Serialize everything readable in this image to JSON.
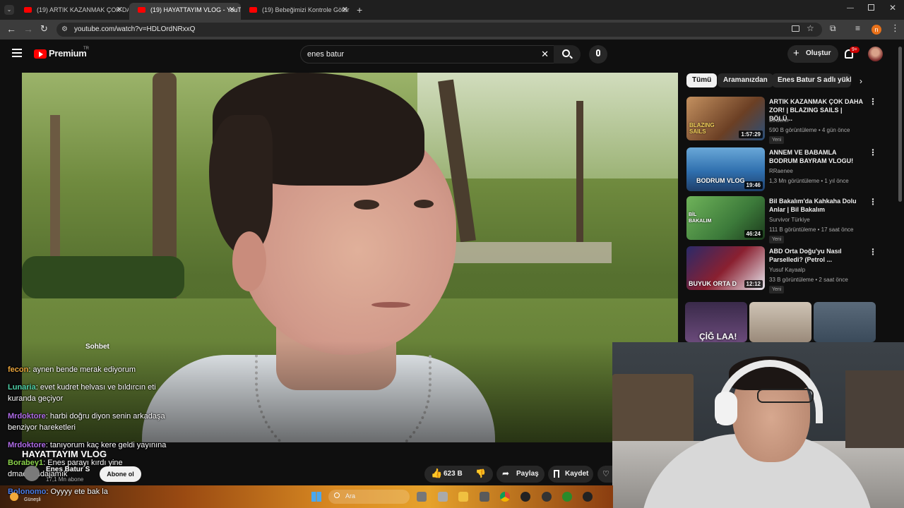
{
  "browser": {
    "tabs": [
      {
        "label": "(19) ARTIK KAZANMAK ÇOK DA",
        "active": false
      },
      {
        "label": "(19) HAYATTAYIM VLOG - YouT",
        "active": true
      },
      {
        "label": "(19) Bebeğimizi Kontrole Götür",
        "active": false
      }
    ],
    "url": "youtube.com/watch?v=HDLOrdNRxxQ",
    "profile_letter": "n"
  },
  "youtube": {
    "logo": "Premium",
    "logo_suffix": "TR",
    "search_value": "enes batur",
    "create_label": "Oluştur",
    "notifications_count": "9+"
  },
  "video": {
    "title": "HAYATTAYIM VLOG",
    "channel": "Enes Batur S",
    "subscribers": "17,1 Mn abone",
    "subscribe_label": "Abone ol",
    "likes": "623 B",
    "share_label": "Paylaş",
    "save_label": "Kaydet",
    "chat_heading": "Sohbet"
  },
  "chips": [
    "Tümü",
    "Aramanızdan",
    "Enes Batur S adlı yükley"
  ],
  "sidebar_videos": [
    {
      "title": "ARTIK KAZANMAK ÇOK DAHA ZOR! | BLAZING SAILS | BÖLÜ...",
      "channel": "Elraenn",
      "meta": "590 B görüntüleme • 4 gün önce",
      "badge": "Yeni",
      "duration": "1:57:29",
      "color": "#7a4a2a"
    },
    {
      "title": "ANNEM VE BABAMLA BODRUM BAYRAM VLOGU!",
      "channel": "RRaenee",
      "meta": "1,3 Mn görüntüleme • 1 yıl önce",
      "badge": "",
      "duration": "19:46",
      "color": "#2f6fae"
    },
    {
      "title": "Bil Bakalım'da Kahkaha Dolu Anlar | Bil Bakalım",
      "channel": "Survivor Türkiye",
      "meta": "111 B görüntüleme • 17 saat önce",
      "badge": "Yeni",
      "duration": "46:24",
      "color": "#3c7a3a"
    },
    {
      "title": "ABD Orta Doğu'yu Nasıl Parselledi? (Petrol ...",
      "channel": "Yusuf Kayaalp",
      "meta": "33 B görüntüleme • 2 saat önce",
      "badge": "Yeni",
      "duration": "12:12",
      "color": "#5a1f2a"
    }
  ],
  "thumb_texts": [
    "BLAZING SAILS",
    "BODRUM VLOG",
    "BİL BAKALIM",
    "BUYUK ORTA D",
    "ÇİĞ LAA!"
  ],
  "chat": [
    {
      "user": "fecon",
      "text": ": aynen bende merak ediyorum",
      "color": "#e8a33a"
    },
    {
      "user": "Lunaria",
      "text": ": evet kudret helvası ve bıldırcın eti kuranda geçiyor",
      "color": "#4fd1a8"
    },
    {
      "user": "Mrdoktore",
      "text": ": harbi doğru diyon senin arkadaşa benziyor hareketleri",
      "color": "#b06ce8"
    },
    {
      "user": "Mrdoktore",
      "text": ": tanıyorum kaç kere geldi yayınına",
      "color": "#b06ce8"
    },
    {
      "user": "Borabey1",
      "text": ": Enes parayı kırdı yine dmadrısndajamık",
      "color": "#8ad24a"
    },
    {
      "user": "Bolonomo",
      "text": ": Oyyyy ete bak la",
      "color": "#4a7de8"
    }
  ],
  "taskbar": {
    "search_label": "Ara",
    "weather_temp": "",
    "weather_label": "Güneşli"
  },
  "colors": {
    "youtube_red": "#ff0000",
    "bg": "#0f0f0f",
    "chip": "#272727"
  }
}
